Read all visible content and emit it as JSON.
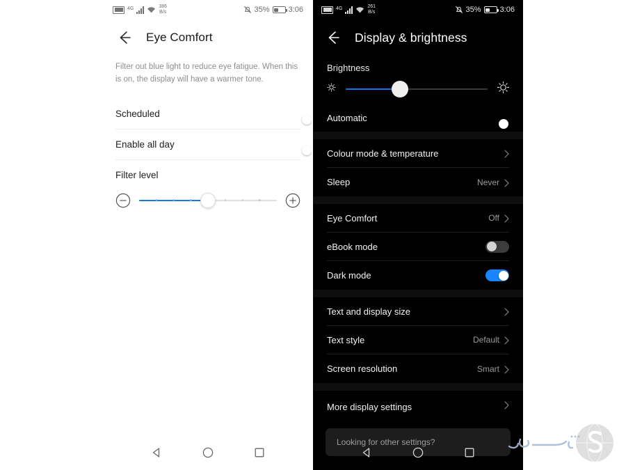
{
  "left_phone": {
    "statusbar": {
      "sim_icon": "sim-card-icon",
      "network_generation": "4G",
      "signal_icon": "signal-bars-icon",
      "wifi_icon": "wifi-icon",
      "data_rate_value": "386",
      "data_rate_unit": "B/s",
      "mute_icon": "ringer-silent-icon",
      "battery_percent": "35%",
      "battery_icon": "battery-icon",
      "clock": "3:06"
    },
    "appbar": {
      "back_icon": "back-arrow-icon",
      "title": "Eye Comfort"
    },
    "description": "Filter out blue light to reduce eye fatigue. When this is on, the display will have a warmer tone.",
    "rows": [
      {
        "label": "Scheduled",
        "toggle": "off"
      },
      {
        "label": "Enable all day",
        "toggle": "off"
      }
    ],
    "filter": {
      "section_label": "Filter level",
      "minus_icon": "minus-circle-icon",
      "plus_icon": "plus-circle-icon",
      "value_percent": 50,
      "tick_count": 9
    },
    "navbar": {
      "back_icon": "nav-back-triangle-icon",
      "home_icon": "nav-home-circle-icon",
      "recents_icon": "nav-recents-square-icon"
    }
  },
  "right_phone": {
    "statusbar": {
      "sim_icon": "sim-card-icon",
      "network_generation": "4G",
      "signal_icon": "signal-bars-icon",
      "wifi_icon": "wifi-icon",
      "data_rate_value": "261",
      "data_rate_unit": "B/s",
      "mute_icon": "ringer-silent-icon",
      "battery_percent": "35%",
      "battery_icon": "battery-icon",
      "clock": "3:06"
    },
    "appbar": {
      "back_icon": "back-arrow-icon",
      "title": "Display & brightness"
    },
    "brightness": {
      "section_label": "Brightness",
      "low_icon": "brightness-low-icon",
      "high_icon": "brightness-high-icon",
      "value_percent": 38,
      "automatic_label": "Automatic",
      "automatic_toggle": "on"
    },
    "groups": [
      {
        "rows": [
          {
            "label": "Colour mode & temperature",
            "value": "",
            "type": "chevron"
          },
          {
            "label": "Sleep",
            "value": "Never",
            "type": "chevron"
          }
        ]
      },
      {
        "rows": [
          {
            "label": "Eye Comfort",
            "value": "Off",
            "type": "chevron"
          },
          {
            "label": "eBook mode",
            "value": "",
            "type": "toggle",
            "toggle": "off"
          },
          {
            "label": "Dark mode",
            "value": "",
            "type": "toggle",
            "toggle": "on"
          }
        ]
      },
      {
        "rows": [
          {
            "label": "Text and display size",
            "value": "",
            "type": "chevron"
          },
          {
            "label": "Text style",
            "value": "Default",
            "type": "chevron"
          },
          {
            "label": "Screen resolution",
            "value": "Smart",
            "type": "chevron"
          }
        ]
      }
    ],
    "more_row": {
      "label": "More display settings",
      "chevron_icon": "chevron-right-icon"
    },
    "search_card": {
      "placeholder": "Looking for other settings?"
    },
    "navbar": {
      "back_icon": "nav-back-triangle-icon",
      "home_icon": "nav-home-circle-icon",
      "recents_icon": "nav-recents-square-icon"
    }
  },
  "watermark": {
    "text": "شهر نخ افزار",
    "logo_icon": "sphere-s-logo-icon"
  },
  "colors": {
    "accent_blue": "#1a73e8",
    "toggle_on": "#1a83ff",
    "dark_bg": "#000000",
    "light_bg": "#ffffff"
  }
}
